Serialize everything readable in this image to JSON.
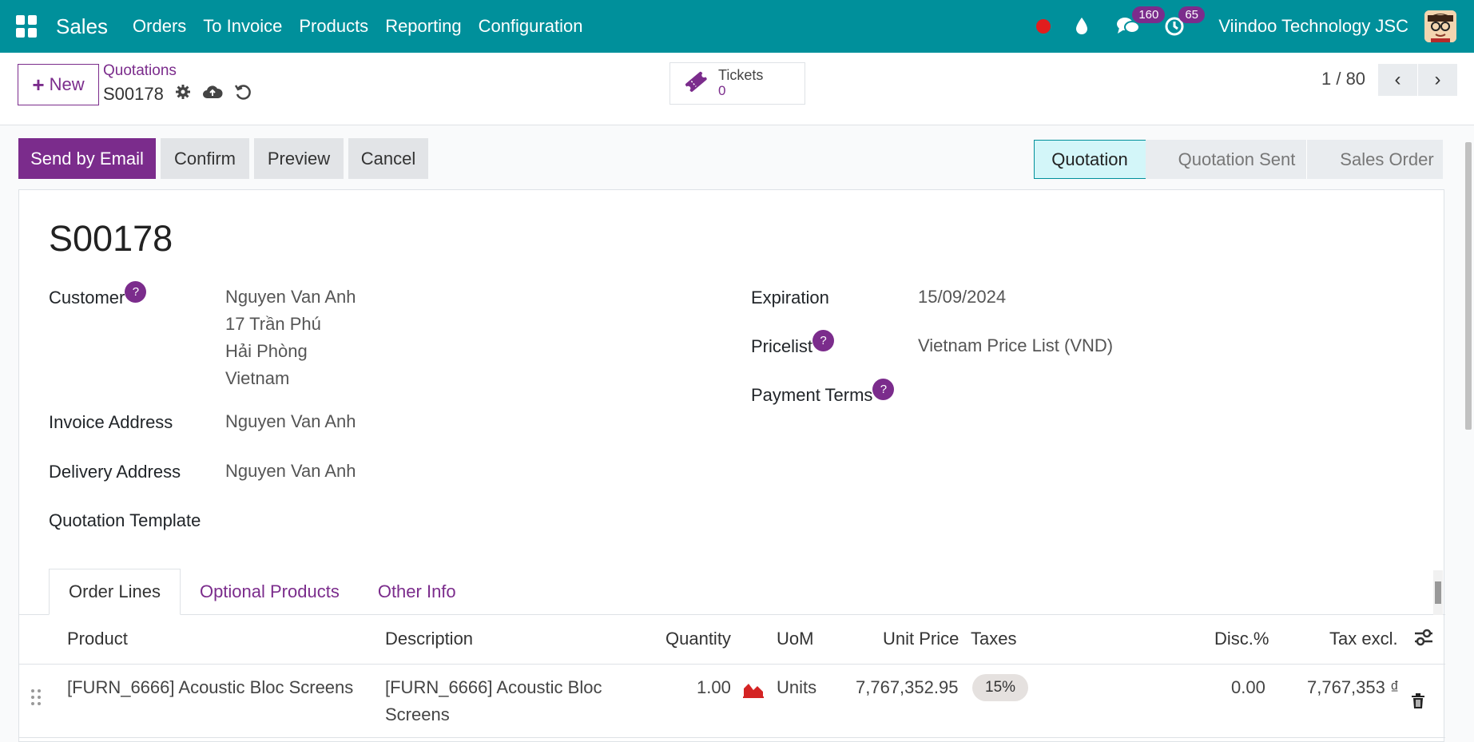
{
  "navbar": {
    "app_name": "Sales",
    "menu": [
      "Orders",
      "To Invoice",
      "Products",
      "Reporting",
      "Configuration"
    ],
    "messages_count": "160",
    "activities_count": "65",
    "company": "Viindoo Technology JSC",
    "brand_color": "#00909b"
  },
  "control_panel": {
    "new_label": "New",
    "breadcrumb_parent": "Quotations",
    "breadcrumb_current": "S00178",
    "tickets_label": "Tickets",
    "tickets_count": "0",
    "pager": "1 / 80"
  },
  "actions": {
    "send_email": "Send by Email",
    "confirm": "Confirm",
    "preview": "Preview",
    "cancel": "Cancel"
  },
  "stages": [
    "Quotation",
    "Quotation Sent",
    "Sales Order"
  ],
  "active_stage": "Quotation",
  "form": {
    "title": "S00178",
    "customer_label": "Customer",
    "customer_lines": [
      "Nguyen Van Anh",
      "17 Trần Phú",
      "Hải Phòng",
      "Vietnam"
    ],
    "invoice_address_label": "Invoice Address",
    "invoice_address": "Nguyen Van Anh",
    "delivery_address_label": "Delivery Address",
    "delivery_address": "Nguyen Van Anh",
    "template_label": "Quotation Template",
    "expiration_label": "Expiration",
    "expiration": "15/09/2024",
    "pricelist_label": "Pricelist",
    "pricelist": "Vietnam Price List (VND)",
    "payment_terms_label": "Payment Terms",
    "help_mark": "?"
  },
  "tabs": [
    "Order Lines",
    "Optional Products",
    "Other Info"
  ],
  "table": {
    "headers": {
      "product": "Product",
      "description": "Description",
      "quantity": "Quantity",
      "uom": "UoM",
      "unit_price": "Unit Price",
      "taxes": "Taxes",
      "discount": "Disc.%",
      "tax_excl": "Tax excl."
    },
    "rows": [
      {
        "product": "[FURN_6666] Acoustic Bloc Screens",
        "description_line1": "[FURN_6666] Acoustic Bloc",
        "description_line2": "Screens",
        "quantity": "1.00",
        "uom": "Units",
        "unit_price": "7,767,352.95",
        "tax": "15%",
        "discount": "0.00",
        "subtotal": "7,767,353 ₫"
      }
    ]
  },
  "colors": {
    "primary": "#7b2c8c",
    "navbar": "#00909b",
    "active_stage_bg": "#d3f6f9"
  }
}
